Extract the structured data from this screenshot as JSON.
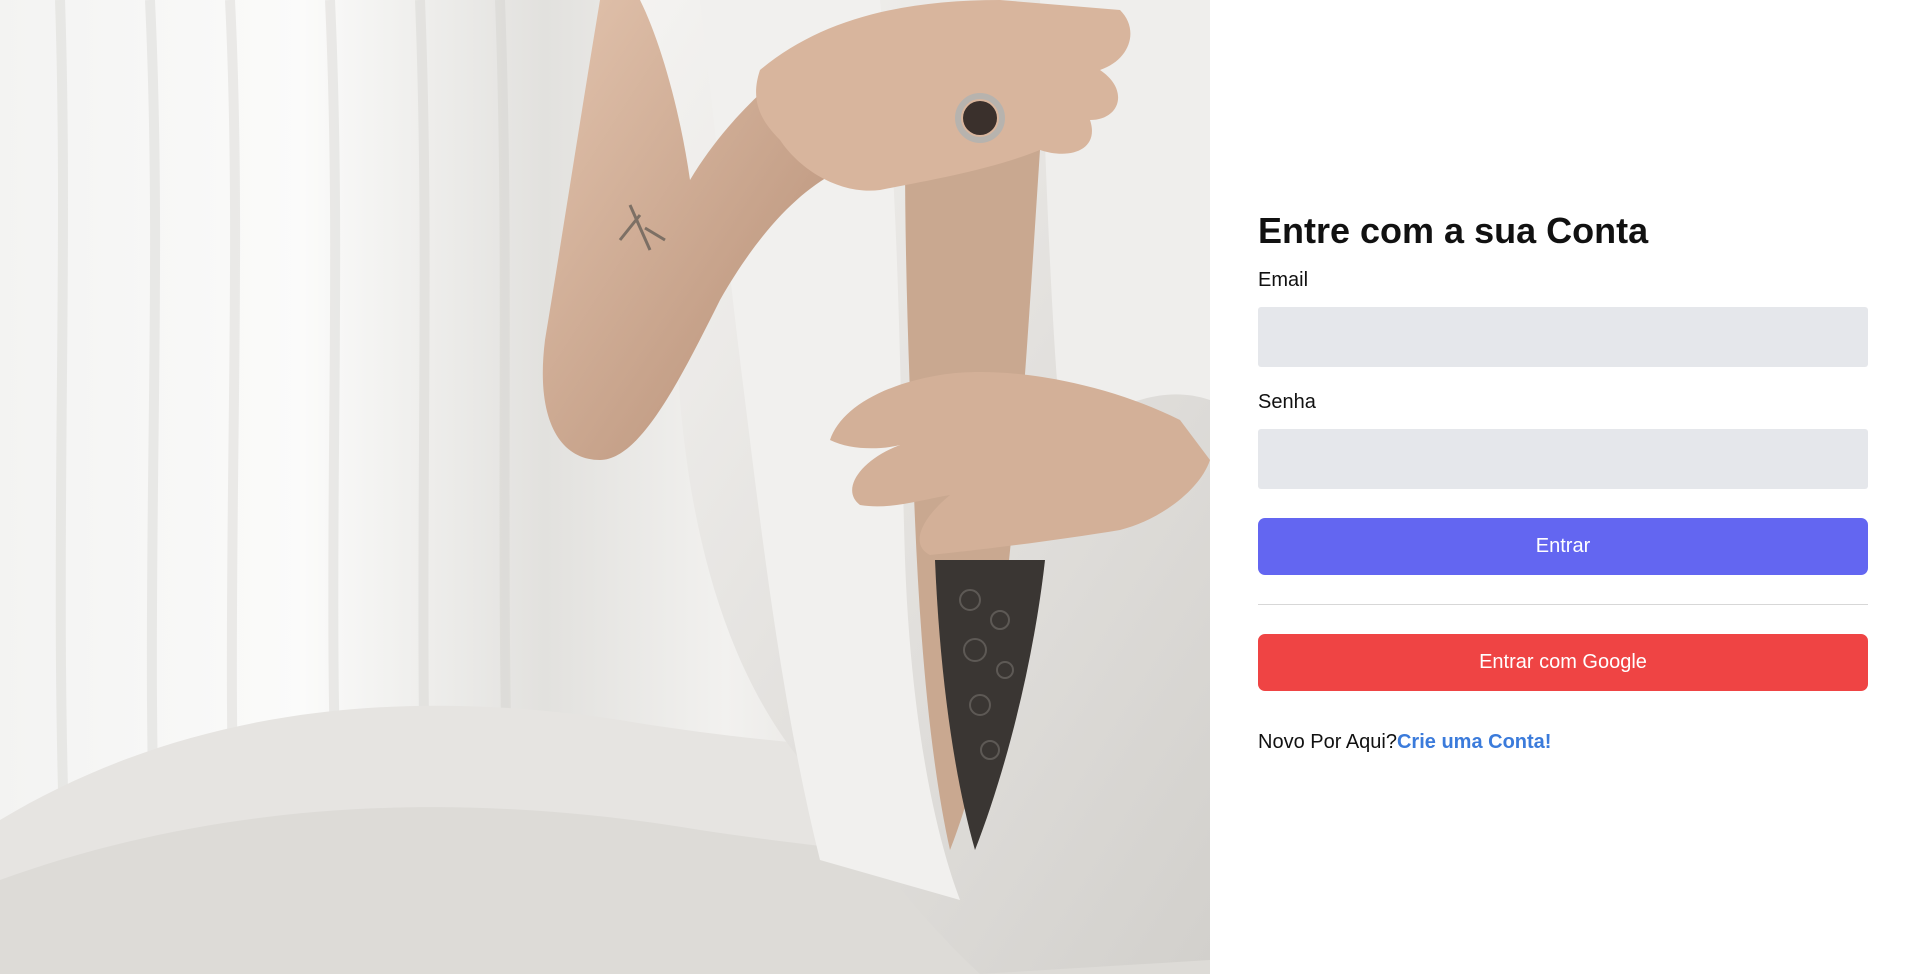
{
  "login": {
    "title": "Entre com a sua Conta",
    "email_label": "Email",
    "email_value": "",
    "password_label": "Senha",
    "password_value": "",
    "submit_label": "Entrar",
    "google_label": "Entrar com Google",
    "signup_prompt": "Novo Por Aqui?",
    "signup_link": "Crie uma Conta!"
  },
  "hero": {
    "icon": "photo-woman-white-robe"
  },
  "colors": {
    "field_bg": "#e5e7eb",
    "primary": "#6366f1",
    "google": "#ef4444",
    "link": "#3b7bdb",
    "divider": "#d7d7d7"
  }
}
